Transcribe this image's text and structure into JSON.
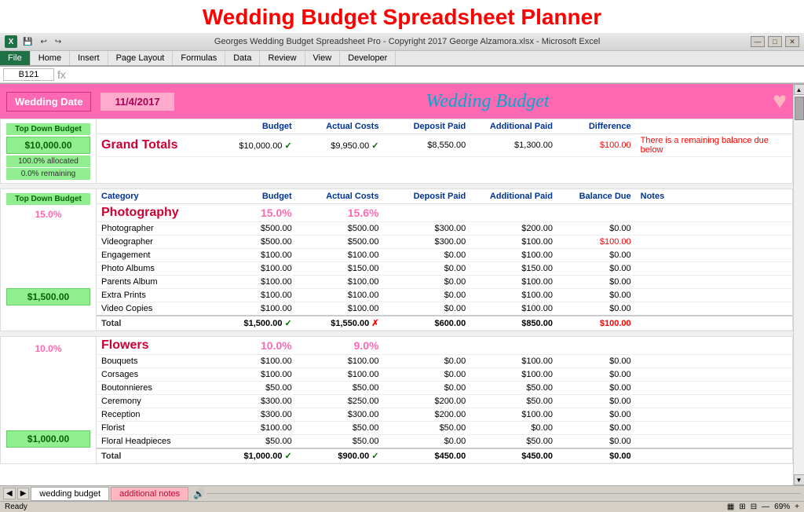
{
  "appTitle": "Wedding Budget Spreadsheet Planner",
  "titleBar": {
    "filename": "Georges Wedding Budget Spreadsheet Pro - Copyright 2017 George Alzamora.xlsx - Microsoft Excel",
    "icon": "X"
  },
  "ribbon": {
    "tabs": [
      "File",
      "Home",
      "Insert",
      "Page Layout",
      "Formulas",
      "Data",
      "Review",
      "View",
      "Developer"
    ]
  },
  "activeCell": "B121",
  "weddingDate": {
    "label": "Wedding Date",
    "value": "11/4/2017",
    "title": "Wedding Budget"
  },
  "grandTotals": {
    "label": "Grand Totals",
    "topDownLabel": "Top Down Budget",
    "budgetAmount": "$10,000.00",
    "actualCosts": "$9,950.00",
    "depositPaid": "$8,550.00",
    "additionalPaid": "$1,300.00",
    "difference": "$100.00",
    "remainingNote": "There is a remaining balance due below",
    "allocText": "100.0% allocated",
    "remainingText": "0.0% remaining"
  },
  "columnHeaders": {
    "category": "Category",
    "budget": "Budget",
    "actualCosts": "Actual Costs",
    "depositPaid": "Deposit Paid",
    "additionalPaid": "Additional Paid",
    "balanceDue": "Balance Due",
    "notes": "Notes"
  },
  "photography": {
    "categoryName": "Photography",
    "topDownLabel": "Top Down Budget",
    "topDownPct": "15.0%",
    "budgetAmount": "$1,500.00",
    "budgetPct": "15.0%",
    "actualPct": "15.6%",
    "items": [
      {
        "name": "Photographer",
        "budget": "$500.00",
        "actual": "$500.00",
        "deposit": "$300.00",
        "additional": "$200.00",
        "balance": "$0.00"
      },
      {
        "name": "Videographer",
        "budget": "$500.00",
        "actual": "$500.00",
        "deposit": "$300.00",
        "additional": "$100.00",
        "balance": "$100.00",
        "balanceRed": true
      },
      {
        "name": "Engagement",
        "budget": "$100.00",
        "actual": "$100.00",
        "deposit": "$0.00",
        "additional": "$100.00",
        "balance": "$0.00"
      },
      {
        "name": "Photo Albums",
        "budget": "$100.00",
        "actual": "$150.00",
        "deposit": "$0.00",
        "additional": "$150.00",
        "balance": "$0.00"
      },
      {
        "name": "Parents Album",
        "budget": "$100.00",
        "actual": "$100.00",
        "deposit": "$0.00",
        "additional": "$100.00",
        "balance": "$0.00"
      },
      {
        "name": "Extra Prints",
        "budget": "$100.00",
        "actual": "$100.00",
        "deposit": "$0.00",
        "additional": "$100.00",
        "balance": "$0.00"
      },
      {
        "name": "Video Copies",
        "budget": "$100.00",
        "actual": "$100.00",
        "deposit": "$0.00",
        "additional": "$100.00",
        "balance": "$0.00"
      }
    ],
    "total": {
      "budget": "$1,500.00",
      "actual": "$1,550.00",
      "deposit": "$600.00",
      "additional": "$850.00",
      "balance": "$100.00",
      "budgetCheck": true,
      "actualX": true,
      "balanceRed": true
    }
  },
  "flowers": {
    "categoryName": "Flowers",
    "topDownPct": "10.0%",
    "budgetAmount": "$1,000.00",
    "budgetPct": "10.0%",
    "actualPct": "9.0%",
    "items": [
      {
        "name": "Bouquets",
        "budget": "$100.00",
        "actual": "$100.00",
        "deposit": "$0.00",
        "additional": "$100.00",
        "balance": "$0.00"
      },
      {
        "name": "Corsages",
        "budget": "$100.00",
        "actual": "$100.00",
        "deposit": "$0.00",
        "additional": "$100.00",
        "balance": "$0.00"
      },
      {
        "name": "Boutonnieres",
        "budget": "$50.00",
        "actual": "$50.00",
        "deposit": "$0.00",
        "additional": "$50.00",
        "balance": "$0.00"
      },
      {
        "name": "Ceremony",
        "budget": "$300.00",
        "actual": "$250.00",
        "deposit": "$200.00",
        "additional": "$50.00",
        "balance": "$0.00"
      },
      {
        "name": "Reception",
        "budget": "$300.00",
        "actual": "$300.00",
        "deposit": "$200.00",
        "additional": "$100.00",
        "balance": "$0.00"
      },
      {
        "name": "Florist",
        "budget": "$100.00",
        "actual": "$50.00",
        "deposit": "$50.00",
        "additional": "$0.00",
        "balance": "$0.00"
      },
      {
        "name": "Floral Headpieces",
        "budget": "$50.00",
        "actual": "$50.00",
        "deposit": "$0.00",
        "additional": "$50.00",
        "balance": "$0.00"
      }
    ],
    "total": {
      "budget": "$1,000.00",
      "actual": "$900.00",
      "deposit": "$450.00",
      "additional": "$450.00",
      "balance": "$0.00",
      "budgetCheck": true,
      "actualCheck": true
    }
  },
  "tabs": [
    {
      "label": "wedding budget",
      "active": true
    },
    {
      "label": "additional notes",
      "pink": true
    }
  ],
  "statusBar": {
    "ready": "Ready",
    "zoom": "69%"
  }
}
